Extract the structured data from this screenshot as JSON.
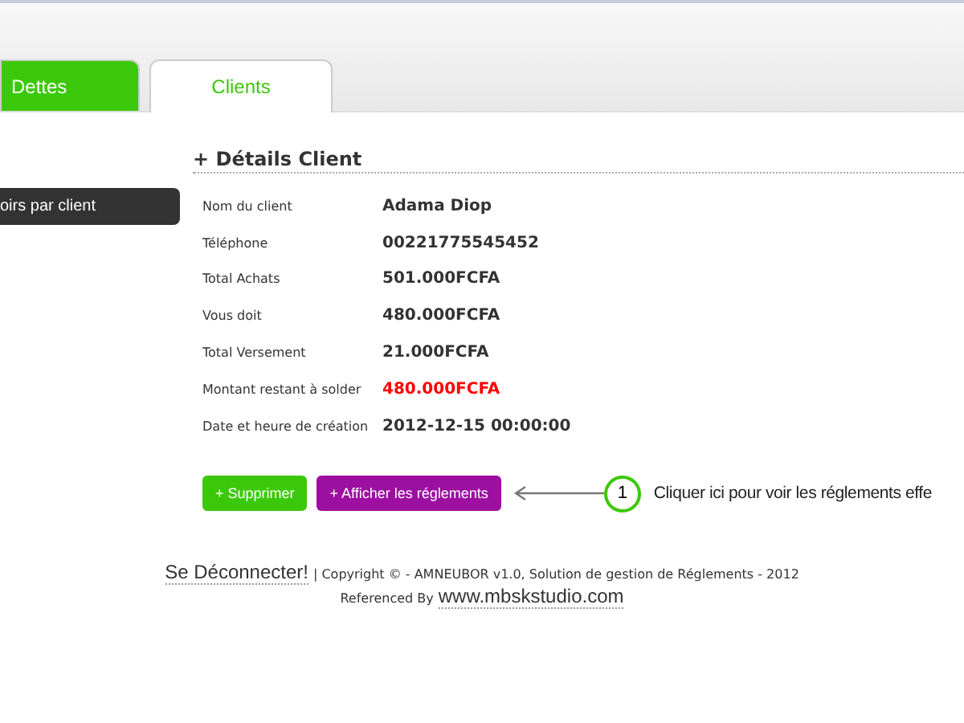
{
  "tabs": [
    {
      "label": "Dettes",
      "selected": false
    },
    {
      "label": "Clients",
      "selected": true
    }
  ],
  "sidebar": {
    "items": [
      {
        "label": "oirs par client"
      }
    ]
  },
  "details": {
    "title": "+ Détails Client",
    "rows": [
      {
        "label": "Nom du client",
        "value": "Adama Diop",
        "warning": false
      },
      {
        "label": "Téléphone",
        "value": "00221775545452",
        "warning": false
      },
      {
        "label": "Total Achats",
        "value": "501.000FCFA",
        "warning": false
      },
      {
        "label": "Vous doit",
        "value": "480.000FCFA",
        "warning": false
      },
      {
        "label": "Total Versement",
        "value": "21.000FCFA",
        "warning": false
      },
      {
        "label": "Montant restant à solder",
        "value": "480.000FCFA",
        "warning": true
      },
      {
        "label": "Date et heure de création",
        "value": "2012-12-15 00:00:00",
        "warning": false
      }
    ]
  },
  "buttons": [
    {
      "label": "+ Supprimer",
      "kind": "delete"
    },
    {
      "label": "+ Afficher les réglements",
      "kind": "show"
    }
  ],
  "callout": {
    "number": "1",
    "text": "Cliquer ici pour voir les réglements effe"
  },
  "footer": {
    "logout": "Se Déconnecter!",
    "copyright": "| Copyright © - AMNEUBOR v1.0, Solution de gestion de Réglements - 2012",
    "referenced": "Referenced By",
    "link": "www.mbskstudio.com"
  }
}
